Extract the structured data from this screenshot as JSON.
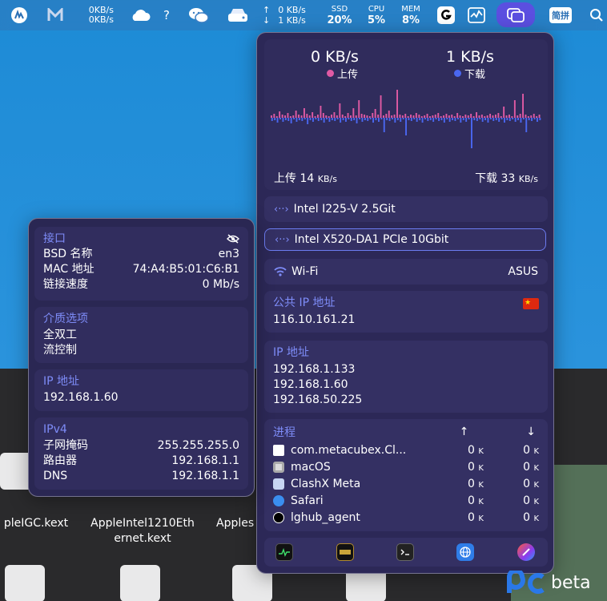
{
  "menubar": {
    "net_upload": "0KB/s",
    "net_download": "0KB/s",
    "question": "?",
    "traffic_up": "0 KB/s",
    "traffic_down": "1 KB/s",
    "ssd_label": "SSD",
    "ssd_value": "20%",
    "cpu_label": "CPU",
    "cpu_value": "5%",
    "mem_label": "MEM",
    "mem_value": "8%",
    "ime_label": "简拼"
  },
  "network_panel": {
    "upload_rate": "0 KB/s",
    "upload_label": "上传",
    "download_rate": "1 KB/s",
    "download_label": "下载",
    "total_upload_label": "上传",
    "total_upload_value": "14",
    "total_download_label": "下载",
    "total_download_value": "33",
    "unit": "KB/s",
    "interfaces": [
      {
        "name": "Intel I225-V 2.5Git"
      },
      {
        "name": "Intel X520-DA1 PCIe 10Gbit"
      }
    ],
    "wifi_label": "Wi-Fi",
    "wifi_ssid": "ASUS",
    "public_ip_label": "公共 IP 地址",
    "public_ip": "116.10.161.21",
    "ip_label": "IP 地址",
    "ips": [
      "192.168.1.133",
      "192.168.1.60",
      "192.168.50.225"
    ],
    "process_label": "进程",
    "processes": [
      {
        "name": "com.metacubex.Cl...",
        "up": "0",
        "down": "0"
      },
      {
        "name": "macOS",
        "up": "0",
        "down": "0"
      },
      {
        "name": "ClashX Meta",
        "up": "0",
        "down": "0"
      },
      {
        "name": "Safari",
        "up": "0",
        "down": "0"
      },
      {
        "name": "lghub_agent",
        "up": "0",
        "down": "0"
      }
    ],
    "k_unit": "K",
    "upload_series": [
      3,
      5,
      2,
      8,
      4,
      3,
      6,
      2,
      3,
      9,
      4,
      3,
      12,
      5,
      3,
      7,
      2,
      4,
      15,
      6,
      3,
      2,
      4,
      7,
      3,
      18,
      4,
      2,
      6,
      3,
      12,
      3,
      22,
      5,
      4,
      3,
      2,
      6,
      11,
      4,
      28,
      3,
      5,
      9,
      3,
      4,
      35,
      4,
      3,
      5,
      2,
      4,
      3,
      6,
      4,
      2,
      3,
      5,
      2,
      3,
      4,
      6,
      2,
      3,
      5,
      3,
      4,
      2,
      6,
      3,
      2,
      4,
      3,
      5,
      2,
      7,
      3,
      4,
      2,
      3,
      5,
      3,
      4,
      6,
      2,
      14,
      3,
      4,
      2,
      22,
      3,
      5,
      30,
      4,
      2,
      3,
      5,
      2,
      4
    ],
    "download_series": [
      4,
      3,
      6,
      2,
      5,
      3,
      4,
      7,
      2,
      5,
      3,
      4,
      2,
      8,
      3,
      5,
      2,
      4,
      3,
      6,
      2,
      5,
      3,
      4,
      2,
      6,
      3,
      5,
      2,
      4,
      3,
      7,
      2,
      5,
      3,
      4,
      2,
      6,
      3,
      5,
      2,
      18,
      3,
      4,
      2,
      6,
      3,
      5,
      2,
      22,
      3,
      4,
      2,
      5,
      3,
      6,
      2,
      4,
      3,
      5,
      2,
      4,
      3,
      6,
      2,
      5,
      3,
      4,
      2,
      6,
      3,
      5,
      2,
      38,
      3,
      4,
      2,
      5,
      3,
      6,
      2,
      4,
      3,
      5,
      2,
      6,
      3,
      4,
      2,
      5,
      3,
      6,
      2,
      18,
      3,
      4,
      2,
      5,
      3
    ]
  },
  "interface_panel": {
    "interface_label": "接口",
    "bsd_label": "BSD 名称",
    "bsd_value": "en3",
    "mac_label": "MAC 地址",
    "mac_value": "74:A4:B5:01:C6:B1",
    "speed_label": "链接速度",
    "speed_value": "0 Mb/s",
    "media_label": "介质选项",
    "media_opt1": "全双工",
    "media_opt2": "流控制",
    "ip_label": "IP 地址",
    "ip_value": "192.168.1.60",
    "ipv4_label": "IPv4",
    "subnet_label": "子网掩码",
    "subnet_value": "255.255.255.0",
    "router_label": "路由器",
    "router_value": "192.168.1.1",
    "dns_label": "DNS",
    "dns_value": "192.168.1.1"
  },
  "desktop": {
    "file1": "pleIGC.kext",
    "file2_line1": "AppleIntel1210Eth",
    "file2_line2": "ernet.kext",
    "file3": "Apples"
  },
  "watermark": {
    "text": "beta"
  }
}
